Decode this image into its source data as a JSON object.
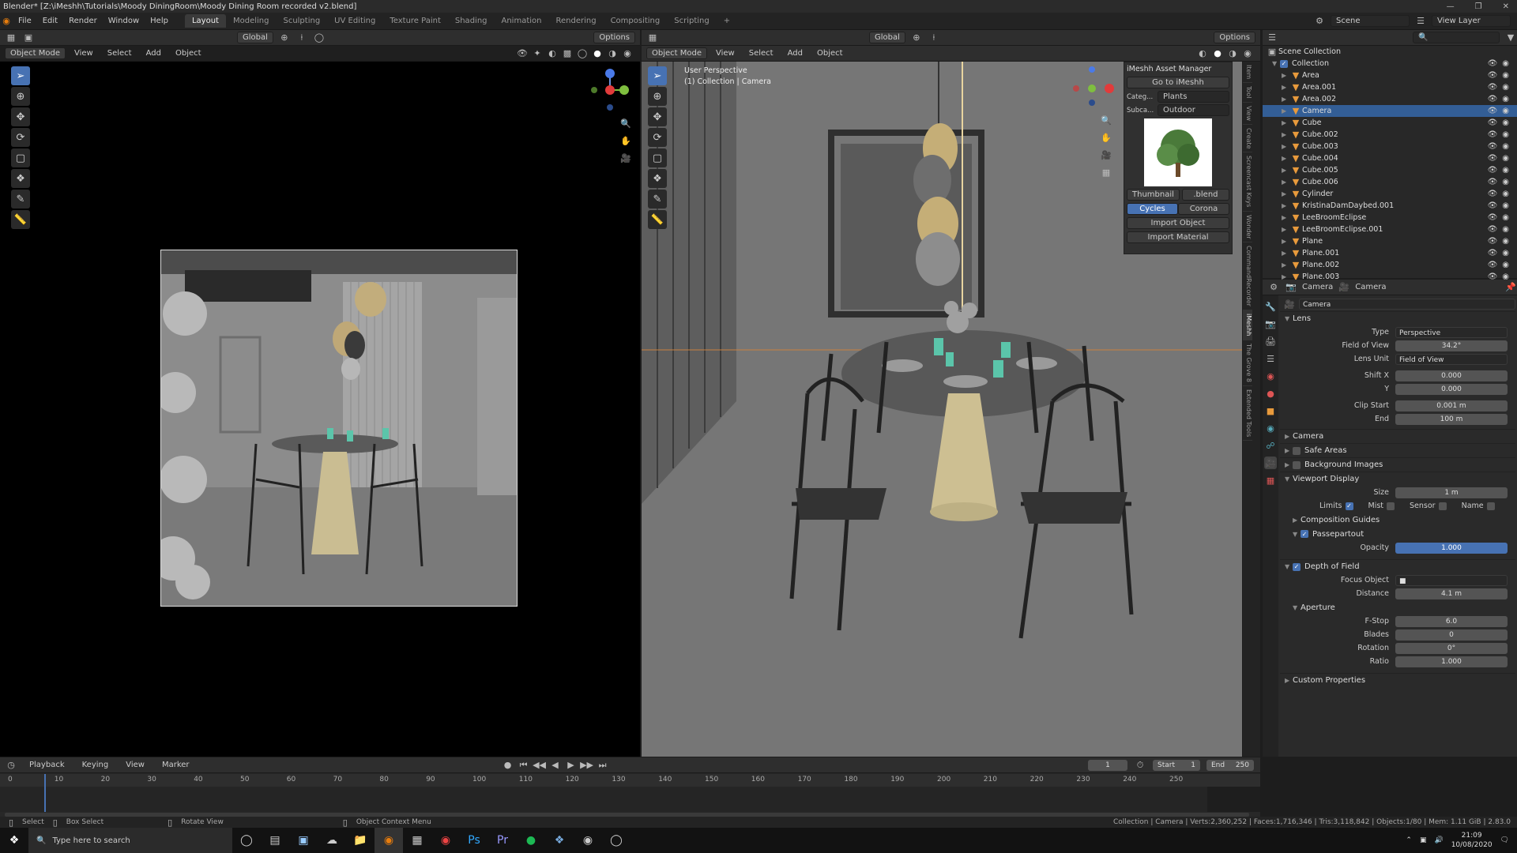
{
  "window": {
    "title": "Blender* [Z:\\iMeshh\\Tutorials\\Moody DiningRoom\\Moody Dining Room recorded v2.blend]"
  },
  "menu": [
    "File",
    "Edit",
    "Render",
    "Window",
    "Help"
  ],
  "workspaces": [
    "Layout",
    "Modeling",
    "Sculpting",
    "UV Editing",
    "Texture Paint",
    "Shading",
    "Animation",
    "Rendering",
    "Compositing",
    "Scripting"
  ],
  "scene": {
    "name": "Scene",
    "view_layer": "View Layer"
  },
  "viewport_header": {
    "mode": "Object Mode",
    "view": "View",
    "select": "Select",
    "add": "Add",
    "object": "Object",
    "orientation": "Global",
    "options": "Options"
  },
  "viewport_right": {
    "perspective_label": "User Perspective",
    "collection_label": "(1) Collection | Camera"
  },
  "imeshh": {
    "title": "iMeshh Asset Manager",
    "goto": "Go to iMeshh",
    "category_label": "Categ...",
    "category": "Plants",
    "subcategory_label": "Subca...",
    "subcategory": "Outdoor",
    "thumbnail": "Thumbnail",
    "blend": ".blend",
    "cycles": "Cycles",
    "corona": "Corona",
    "import_object": "Import Object",
    "import_material": "Import Material"
  },
  "side_tabs": [
    "Item",
    "Tool",
    "View",
    "Create",
    "Screencast Keys",
    "Wonder",
    "CommandRecorder",
    "iMeshh",
    "The Grove 8",
    "Extended Tools"
  ],
  "outliner": {
    "root": "Scene Collection",
    "collection": "Collection",
    "items": [
      "Area",
      "Area.001",
      "Area.002",
      "Camera",
      "Cube",
      "Cube.002",
      "Cube.003",
      "Cube.004",
      "Cube.005",
      "Cube.006",
      "Cylinder",
      "KristinaDamDaybed.001",
      "LeeBroomEclipse",
      "LeeBroomEclipse.001",
      "Plane",
      "Plane.001",
      "Plane.002",
      "Plane.003"
    ],
    "selected": "Camera"
  },
  "props": {
    "object": "Camera",
    "data": "Camera",
    "data_name": "Camera",
    "lens": {
      "header": "Lens",
      "type_label": "Type",
      "type": "Perspective",
      "fov_label": "Field of View",
      "fov": "34.2°",
      "lens_unit_label": "Lens Unit",
      "lens_unit": "Field of View",
      "shift_x_label": "Shift X",
      "shift_x": "0.000",
      "shift_y_label": "Y",
      "shift_y": "0.000",
      "clip_start_label": "Clip Start",
      "clip_start": "0.001 m",
      "clip_end_label": "End",
      "clip_end": "100 m"
    },
    "camera_panel": "Camera",
    "safe_areas": "Safe Areas",
    "background_images": "Background Images",
    "viewport_display": {
      "header": "Viewport Display",
      "size_label": "Size",
      "size": "1 m",
      "limits": "Limits",
      "mist": "Mist",
      "sensor": "Sensor",
      "name": "Name",
      "composition_guides": "Composition Guides",
      "passepartout": "Passepartout",
      "opacity_label": "Opacity",
      "opacity": "1.000"
    },
    "dof": {
      "header": "Depth of Field",
      "focus_object_label": "Focus Object",
      "distance_label": "Distance",
      "distance": "4.1 m",
      "aperture": "Aperture",
      "fstop_label": "F-Stop",
      "fstop": "6.0",
      "blades_label": "Blades",
      "blades": "0",
      "rotation_label": "Rotation",
      "rotation": "0°",
      "ratio_label": "Ratio",
      "ratio": "1.000"
    },
    "custom_properties": "Custom Properties"
  },
  "timeline": {
    "playback": "Playback",
    "keying": "Keying",
    "view": "View",
    "marker": "Marker",
    "current": "1",
    "start_label": "Start",
    "start": "1",
    "end_label": "End",
    "end": "250",
    "ticks": [
      "0",
      "10",
      "20",
      "30",
      "40",
      "50",
      "60",
      "70",
      "80",
      "90",
      "100",
      "110",
      "120",
      "130",
      "140",
      "150",
      "160",
      "170",
      "180",
      "190",
      "200",
      "210",
      "220",
      "230",
      "240",
      "250"
    ]
  },
  "status": {
    "select": "Select",
    "box_select": "Box Select",
    "rotate_view": "Rotate View",
    "context_menu": "Object Context Menu",
    "stats": "Collection | Camera | Verts:2,360,252 | Faces:1,716,346 | Tris:3,118,842 | Objects:1/80 | Mem: 1.11 GiB | 2.83.0"
  },
  "taskbar": {
    "search": "Type here to search",
    "time": "21:09",
    "date": "10/08/2020"
  }
}
